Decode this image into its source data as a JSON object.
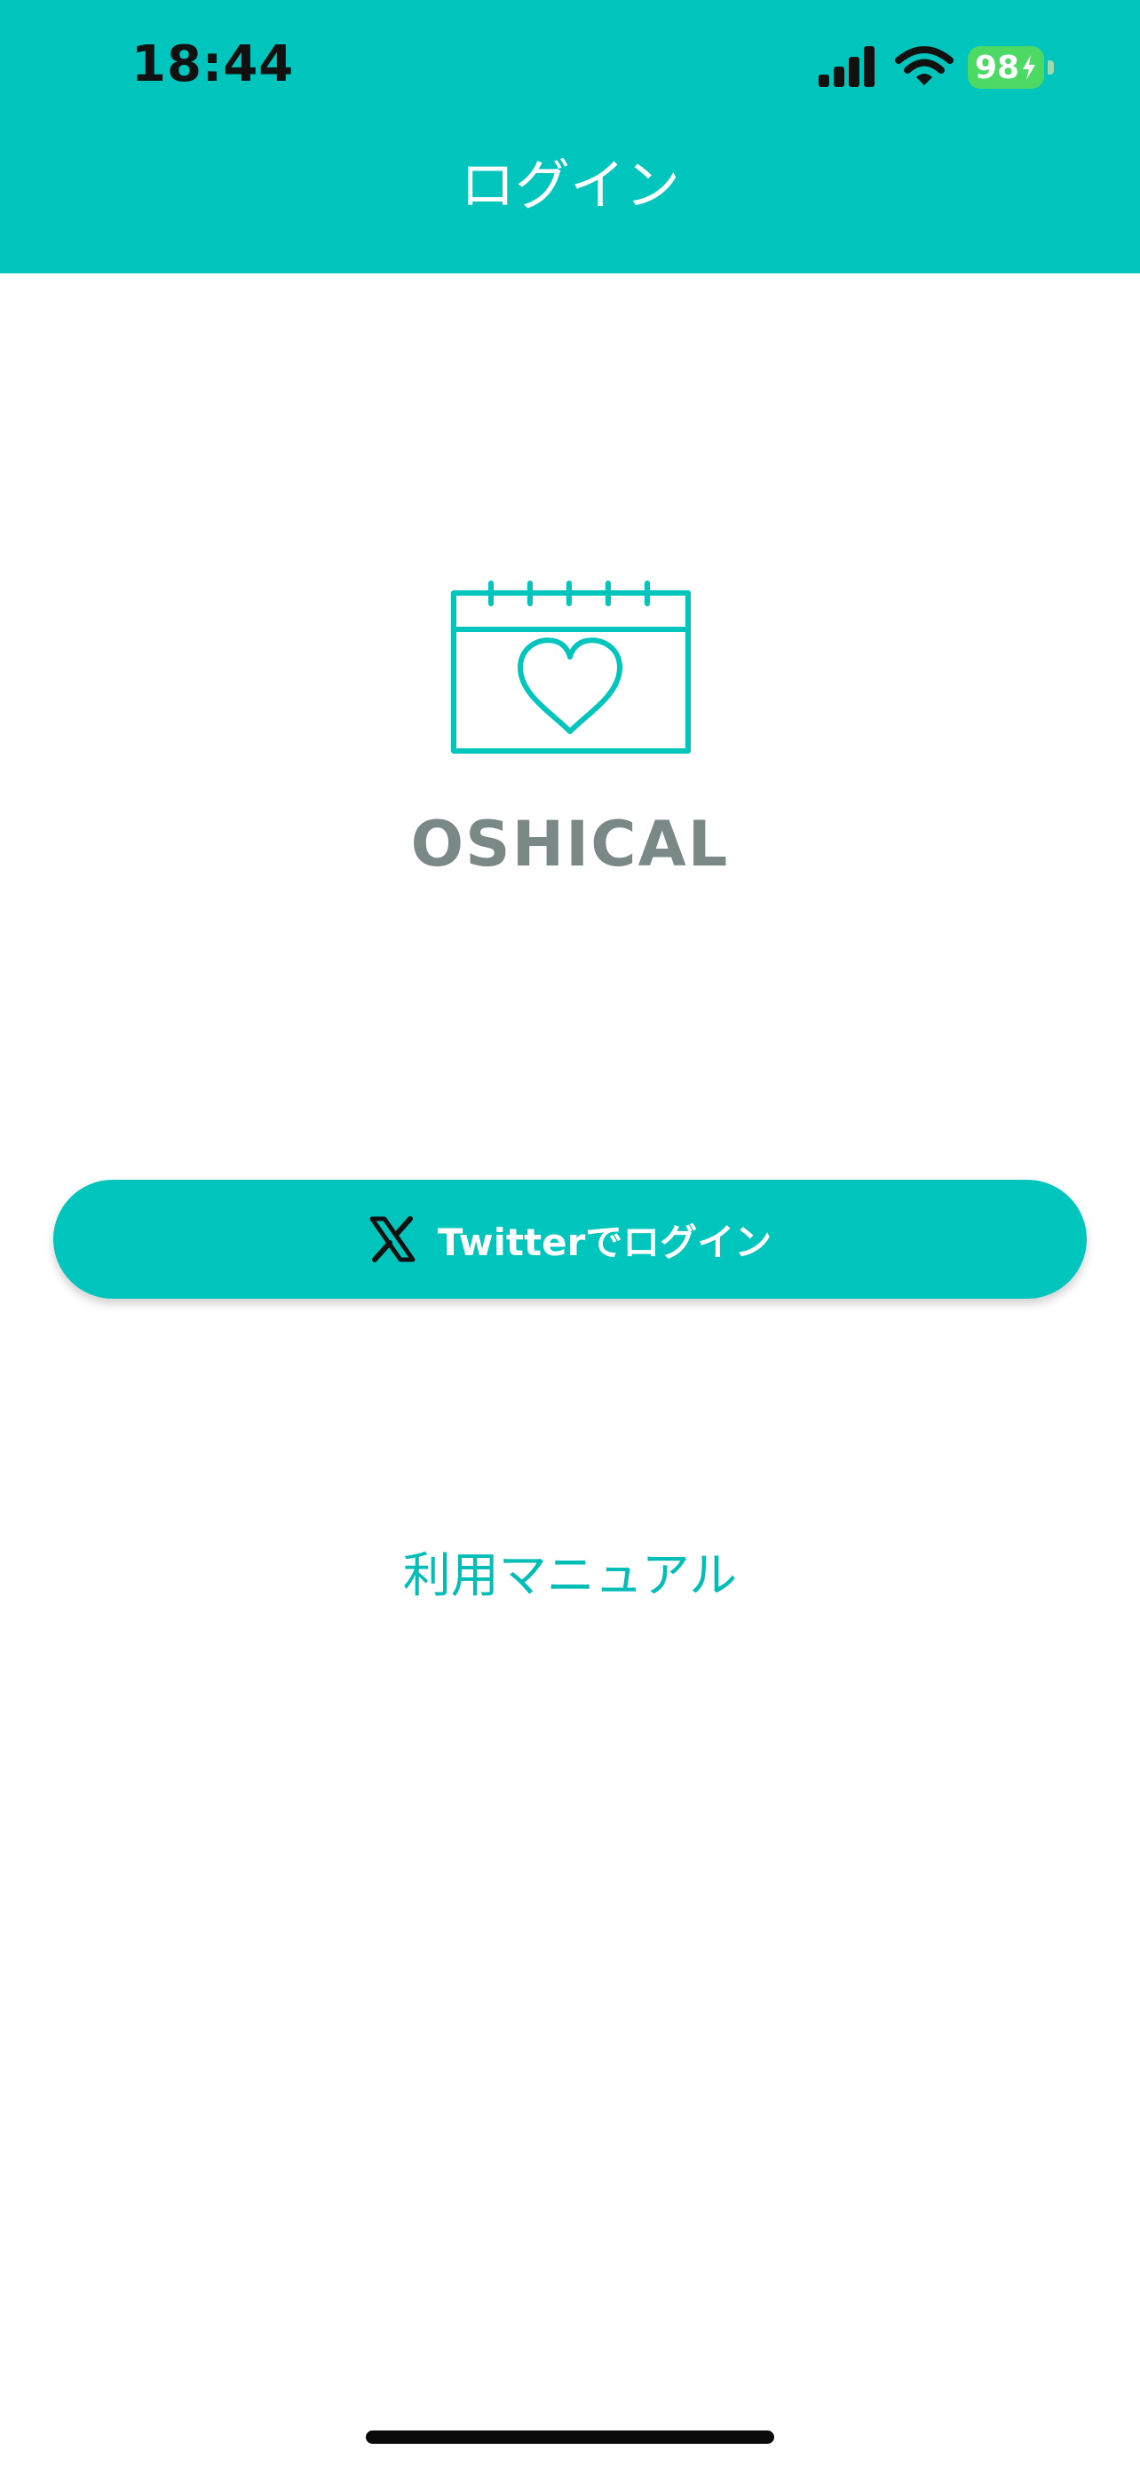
{
  "status_bar": {
    "time": "18:44",
    "battery_level": "98",
    "signal_icon": "cellular-signal-icon",
    "wifi_icon": "wifi-icon",
    "battery_icon": "battery-charging-icon"
  },
  "header": {
    "title": "ログイン",
    "background_color": "#00C5BC"
  },
  "logo": {
    "icon": "calendar-heart-icon",
    "brand_name": "OSHICAL",
    "accent_color": "#00C5BC",
    "brand_color": "#7A8986"
  },
  "login": {
    "icon": "x-logo-icon",
    "label": "Twitterでログイン"
  },
  "manual": {
    "label": "利用マニュアル"
  }
}
